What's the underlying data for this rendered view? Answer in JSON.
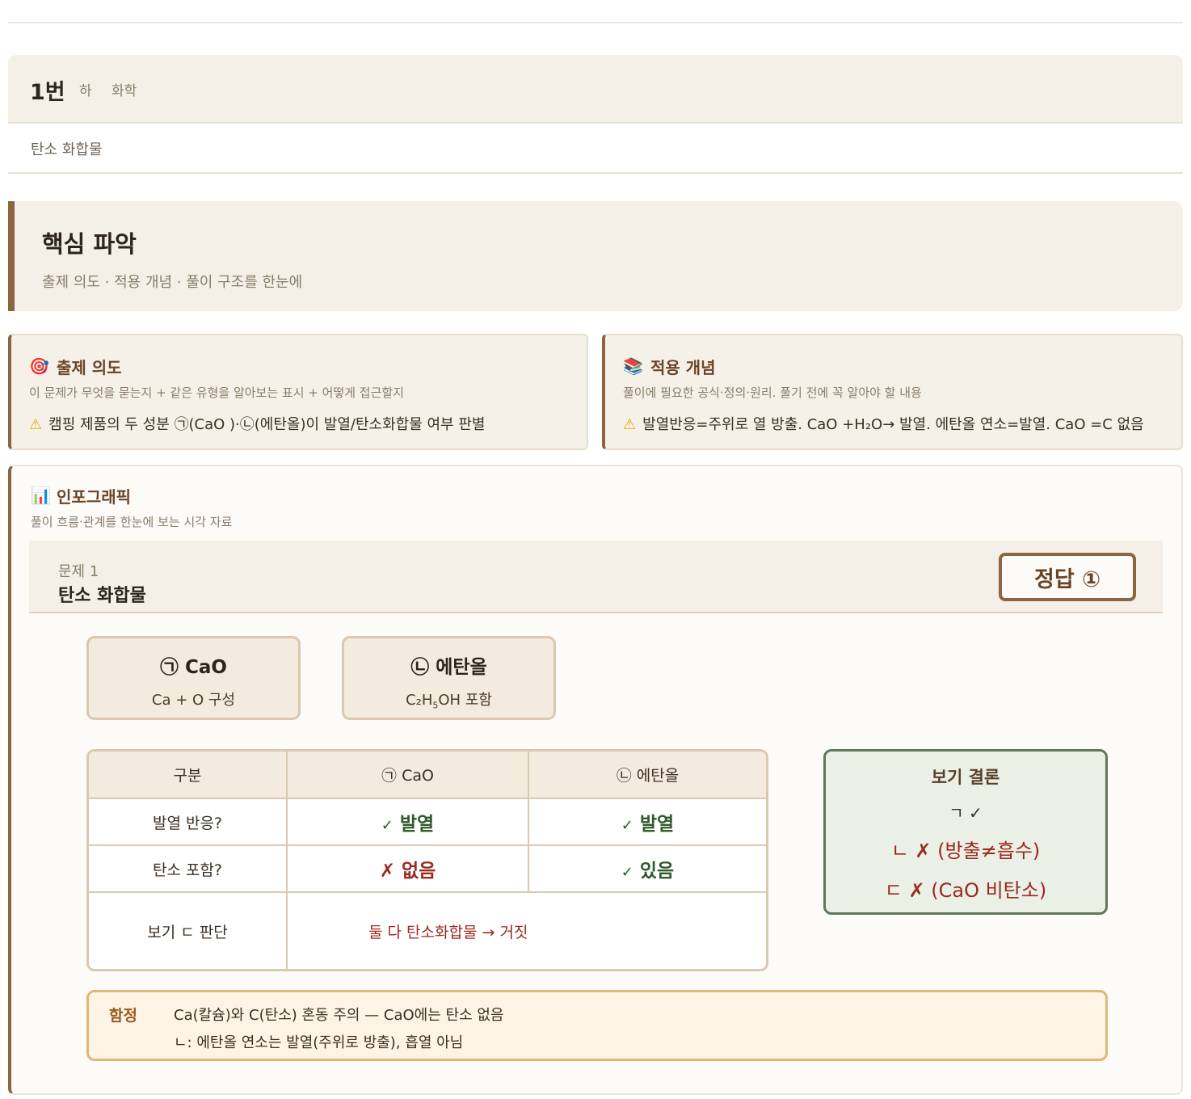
{
  "problem": {
    "number": "1번",
    "level": "하",
    "subject": "화학",
    "topic": "탄소 화합물"
  },
  "core": {
    "title": "핵심 파악",
    "subtitle": "출제 의도 · 적용 개념 · 풀이 구조를 한눈에"
  },
  "cards": {
    "intent": {
      "icon": "target-icon",
      "title": "출제 의도",
      "desc": "이 문제가 무엇을 묻는지 + 같은 유형을 알아보는 표시 + 어떻게 접근할지",
      "warning": "캠핑 제품의 두 성분 ㉠(CaO )·㉡(에탄올)이 발열/탄소화합물 여부 판별"
    },
    "concept": {
      "icon": "books-icon",
      "title": "적용 개념",
      "desc": "풀이에 필요한 공식·정의·원리. 풀기 전에 꼭 알아야 할 내용",
      "warning": "발열반응=주위로 열 방출. CaO +H₂O→ 발열. 에탄올 연소=발열. CaO =C 없음"
    }
  },
  "infographic": {
    "icon": "bar-chart-icon",
    "title": "인포그래픽",
    "subtitle": "풀이 흐름·관계를 한눈에 보는 시각 자료",
    "question_label": "문제 1",
    "question_name": "탄소 화합물",
    "answer": "정답 ①",
    "chip_a": {
      "title": "㉠ CaO",
      "sub": "Ca + O 구성"
    },
    "chip_b": {
      "title": "㉡ 에탄올",
      "sub_pre": "C₂H",
      "sub_subscript": "5",
      "sub_post": "OH 포함"
    },
    "table": {
      "headers": [
        "구분",
        "㉠ CaO",
        "㉡ 에탄올"
      ],
      "rows": [
        {
          "label": "발열 반응?",
          "a_mark": "✓",
          "a_text": "발열",
          "b_mark": "✓",
          "b_text": "발열"
        },
        {
          "label": "탄소 포함?",
          "a_mark": "✗",
          "a_text": "없음",
          "b_mark": "✓",
          "b_text": "있음"
        }
      ],
      "last_label": "보기 ㄷ 판단",
      "last_verdict": "둘 다 탄소화합물 → 거짓"
    },
    "conclusion": {
      "title": "보기 결론",
      "lines": [
        "ㄱ ✓",
        "ㄴ ✗ (방출≠흡수)",
        "ㄷ ✗ (CaO 비탄소)"
      ]
    },
    "trap": {
      "label": "함정",
      "line1": "Ca(칼슘)와 C(탄소) 혼동 주의 — CaO에는 탄소 없음",
      "line2": "ㄴ: 에탄올 연소는 발열(주위로 방출), 흡열 아님"
    }
  }
}
